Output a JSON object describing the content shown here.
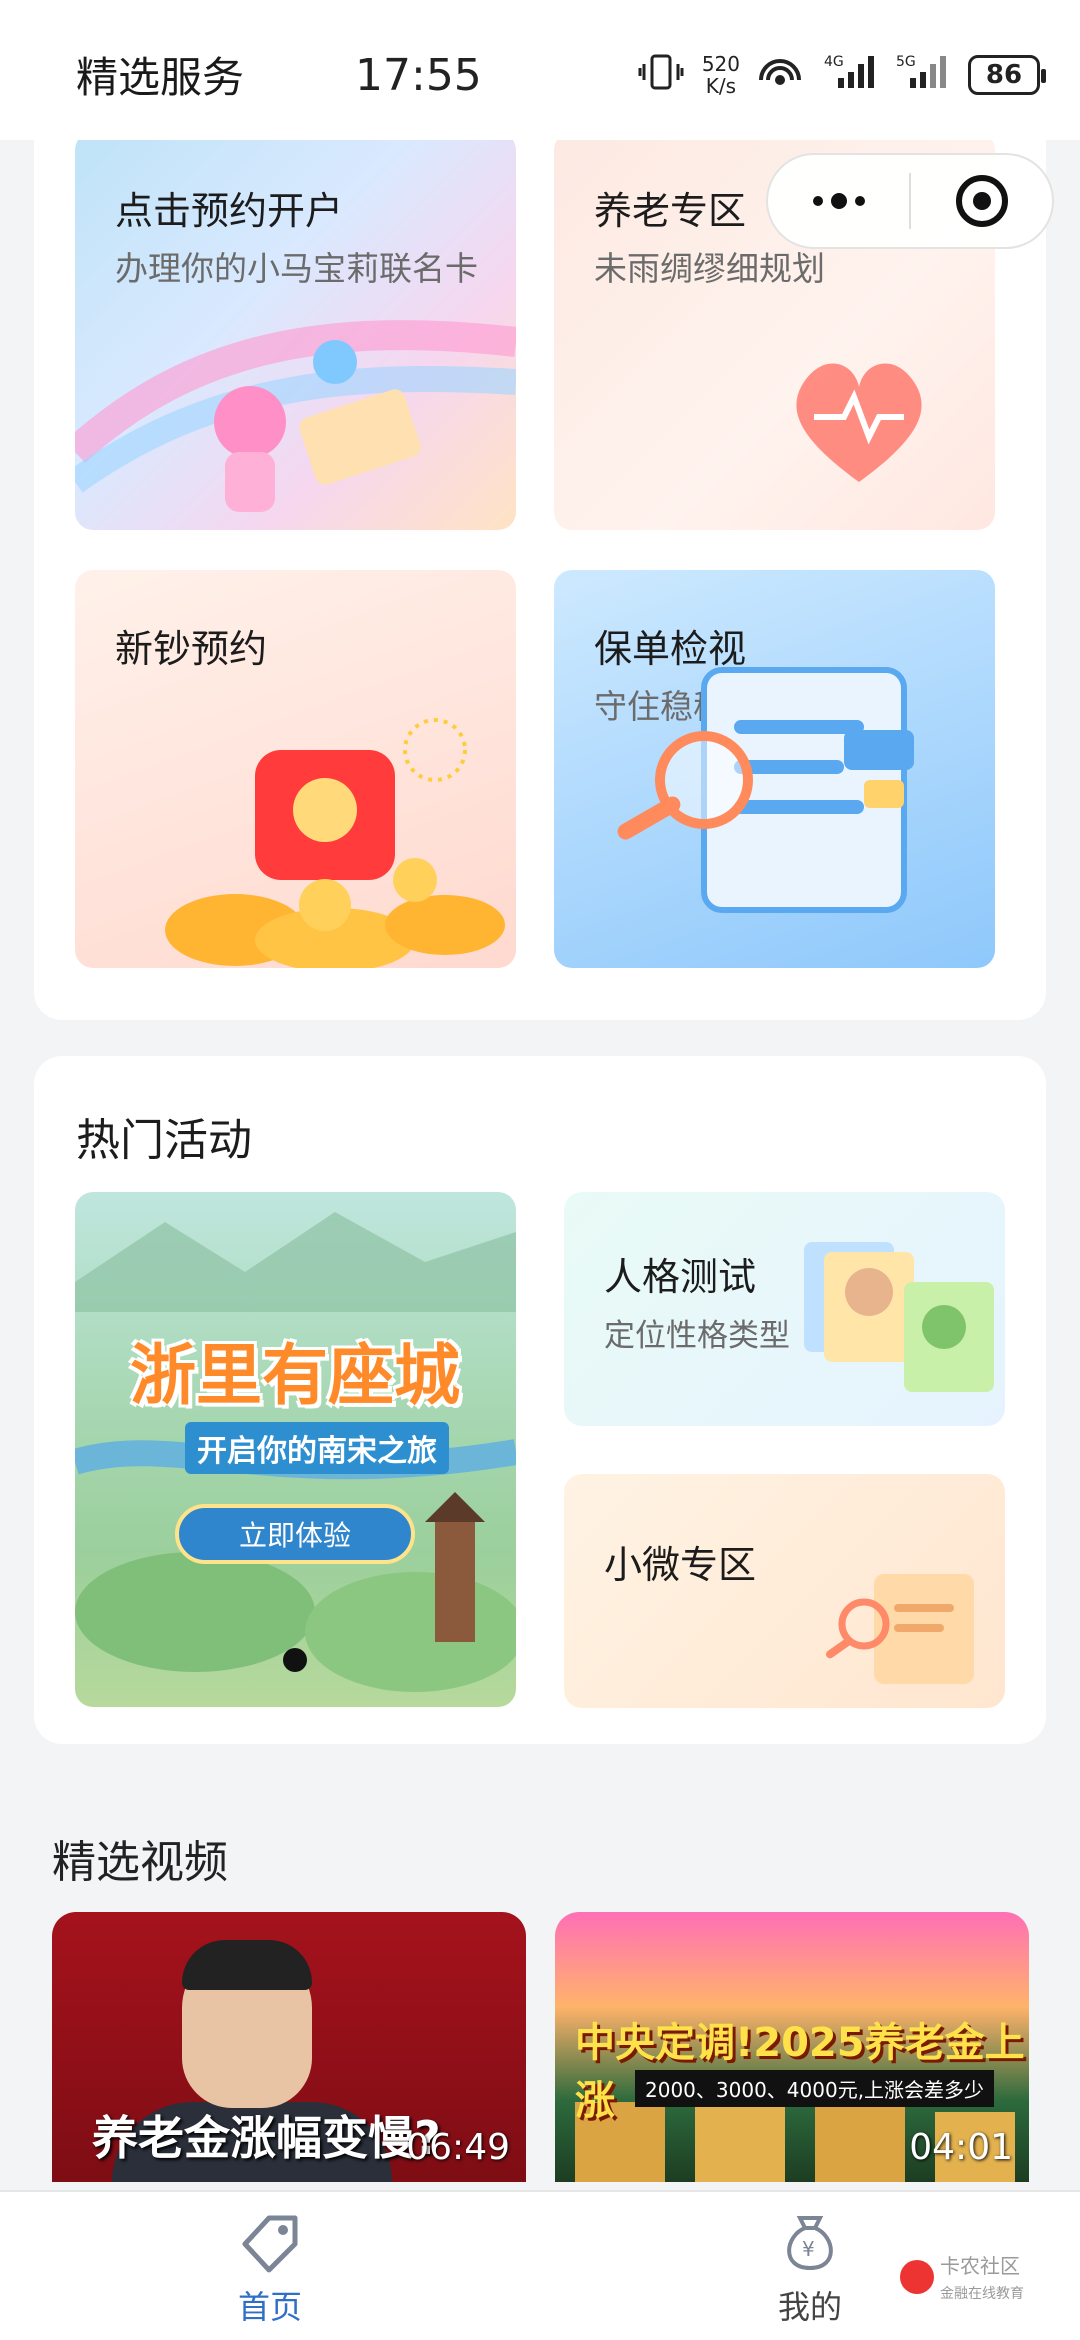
{
  "status_bar": {
    "time": "17:55",
    "net_speed": "520",
    "net_speed_unit": "K/s",
    "hotspot_sup": "1",
    "sig1": "4G",
    "sig2": "5G",
    "battery": "86"
  },
  "services": {
    "title": "精选服务",
    "tiles": [
      {
        "title": "点击预约开户",
        "subtitle": "办理你的小马宝莉联名卡"
      },
      {
        "title": "养老专区",
        "subtitle": "未雨绸缪细规划"
      },
      {
        "title": "新钞预约",
        "subtitle": ""
      },
      {
        "title": "保单检视",
        "subtitle": "守住稳稳的幸福"
      }
    ]
  },
  "capsule": {
    "menu_icon": "more-dots-icon",
    "close_icon": "target-circle-icon"
  },
  "hot": {
    "title": "热门活动",
    "banner": {
      "title": "浙里有座城",
      "subtitle": "开启你的南宋之旅",
      "button": "立即体验"
    },
    "tiles": [
      {
        "title": "人格测试",
        "subtitle": "定位性格类型"
      },
      {
        "title": "小微专区",
        "subtitle": ""
      }
    ]
  },
  "videos": {
    "title": "精选视频",
    "items": [
      {
        "caption": "养老金涨幅变慢?",
        "duration": "06:49"
      },
      {
        "caption": "中央定调!2025养老金上涨",
        "strip": "2000、3000、4000元,上涨会差多少",
        "duration": "04:01"
      }
    ]
  },
  "tabbar": {
    "items": [
      {
        "label": "首页",
        "icon": "price-tag-icon",
        "active": true
      },
      {
        "label": "我的",
        "icon": "money-bag-icon",
        "active": false
      }
    ]
  },
  "watermark": {
    "text": "卡农社区",
    "sub": "金融在线教育"
  },
  "colors": {
    "accent": "#2f6fc8",
    "background": "#f3f4f6",
    "card": "#ffffff"
  }
}
